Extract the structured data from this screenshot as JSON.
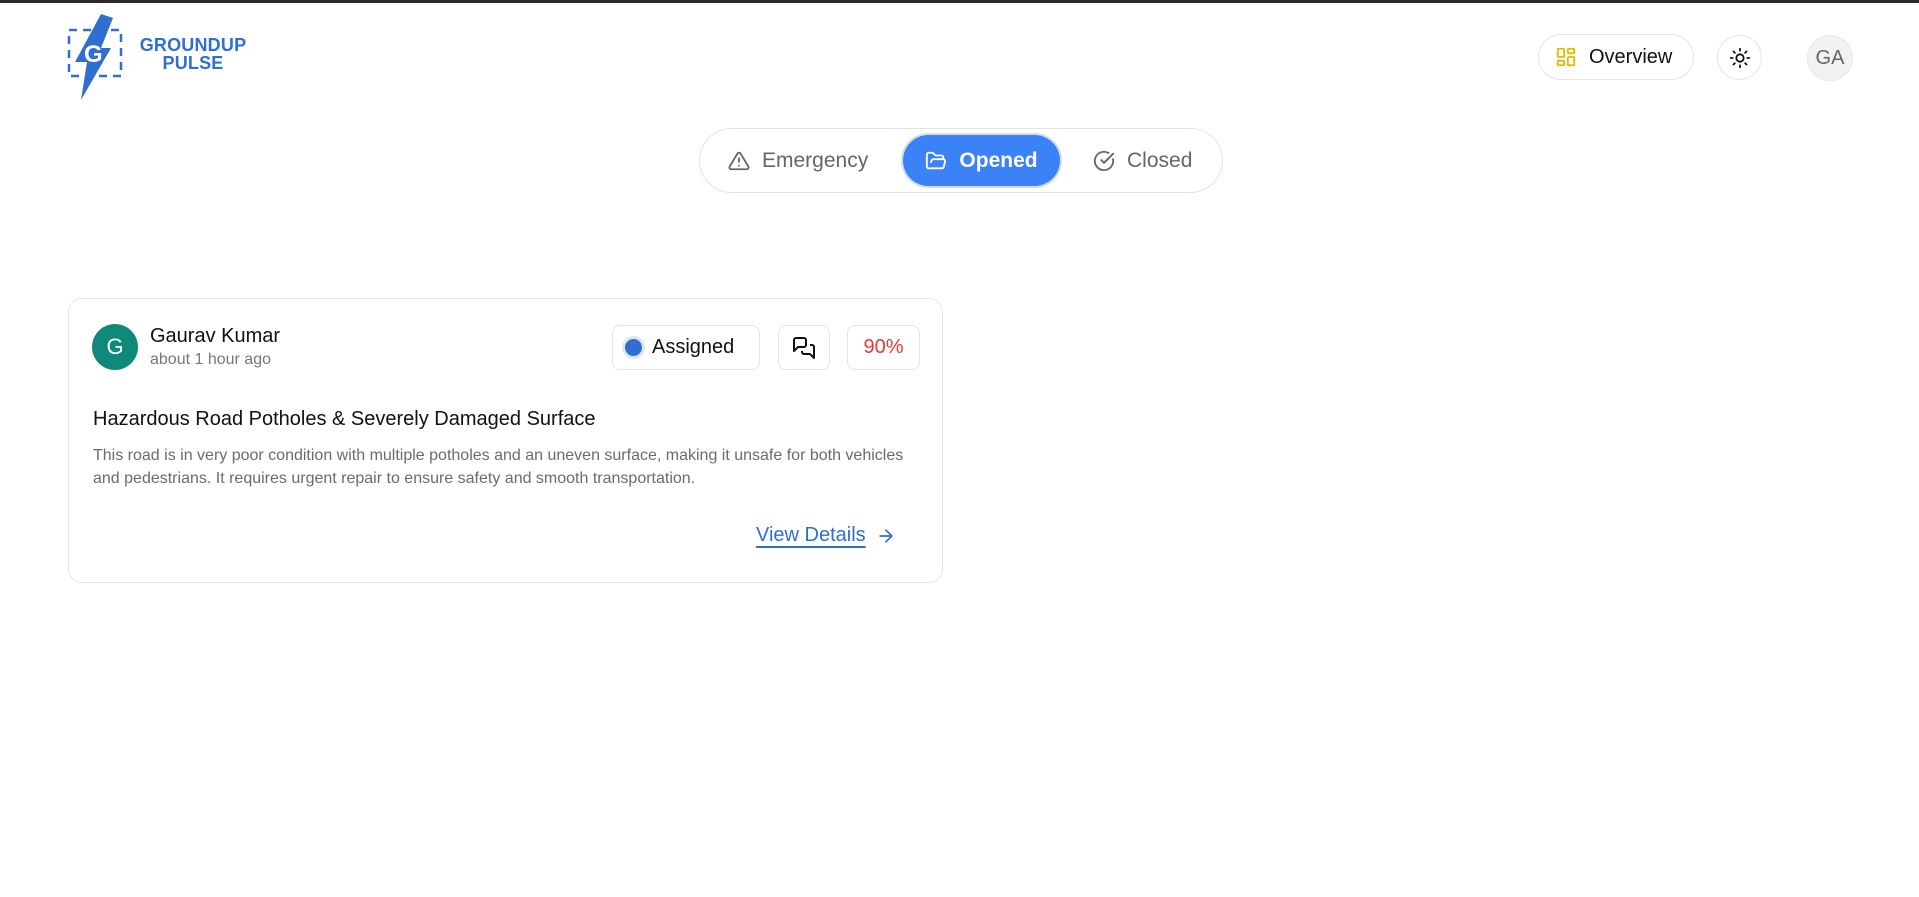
{
  "app": {
    "logo_line1": "GROUNDUP",
    "logo_line2": "PULSE",
    "brand_color": "#2f6fd0"
  },
  "header": {
    "overview_label": "Overview",
    "overview_icon": "layout-grid-icon",
    "theme_icon": "sun-icon",
    "user_initials": "GA"
  },
  "tabs": [
    {
      "label": "Emergency",
      "icon": "alert-triangle-icon",
      "active": false
    },
    {
      "label": "Opened",
      "icon": "folder-open-icon",
      "active": true
    },
    {
      "label": "Closed",
      "icon": "check-circle-icon",
      "active": false
    }
  ],
  "issues": [
    {
      "author_initial": "G",
      "author_name": "Gaurav Kumar",
      "time_ago": "about 1 hour ago",
      "status": "Assigned",
      "score": "90%",
      "title": "Hazardous Road Potholes & Severely Damaged Surface",
      "description": "This road is in very poor condition with multiple potholes and an uneven surface, making it unsafe for both vehicles and pedestrians. It requires urgent repair to ensure safety and smooth transportation.",
      "link_label": "View Details"
    }
  ],
  "colors": {
    "accent": "#3b82f6",
    "avatar": "#0f8a7a",
    "score": "#e5383b",
    "overview_icon": "#e6b800"
  }
}
